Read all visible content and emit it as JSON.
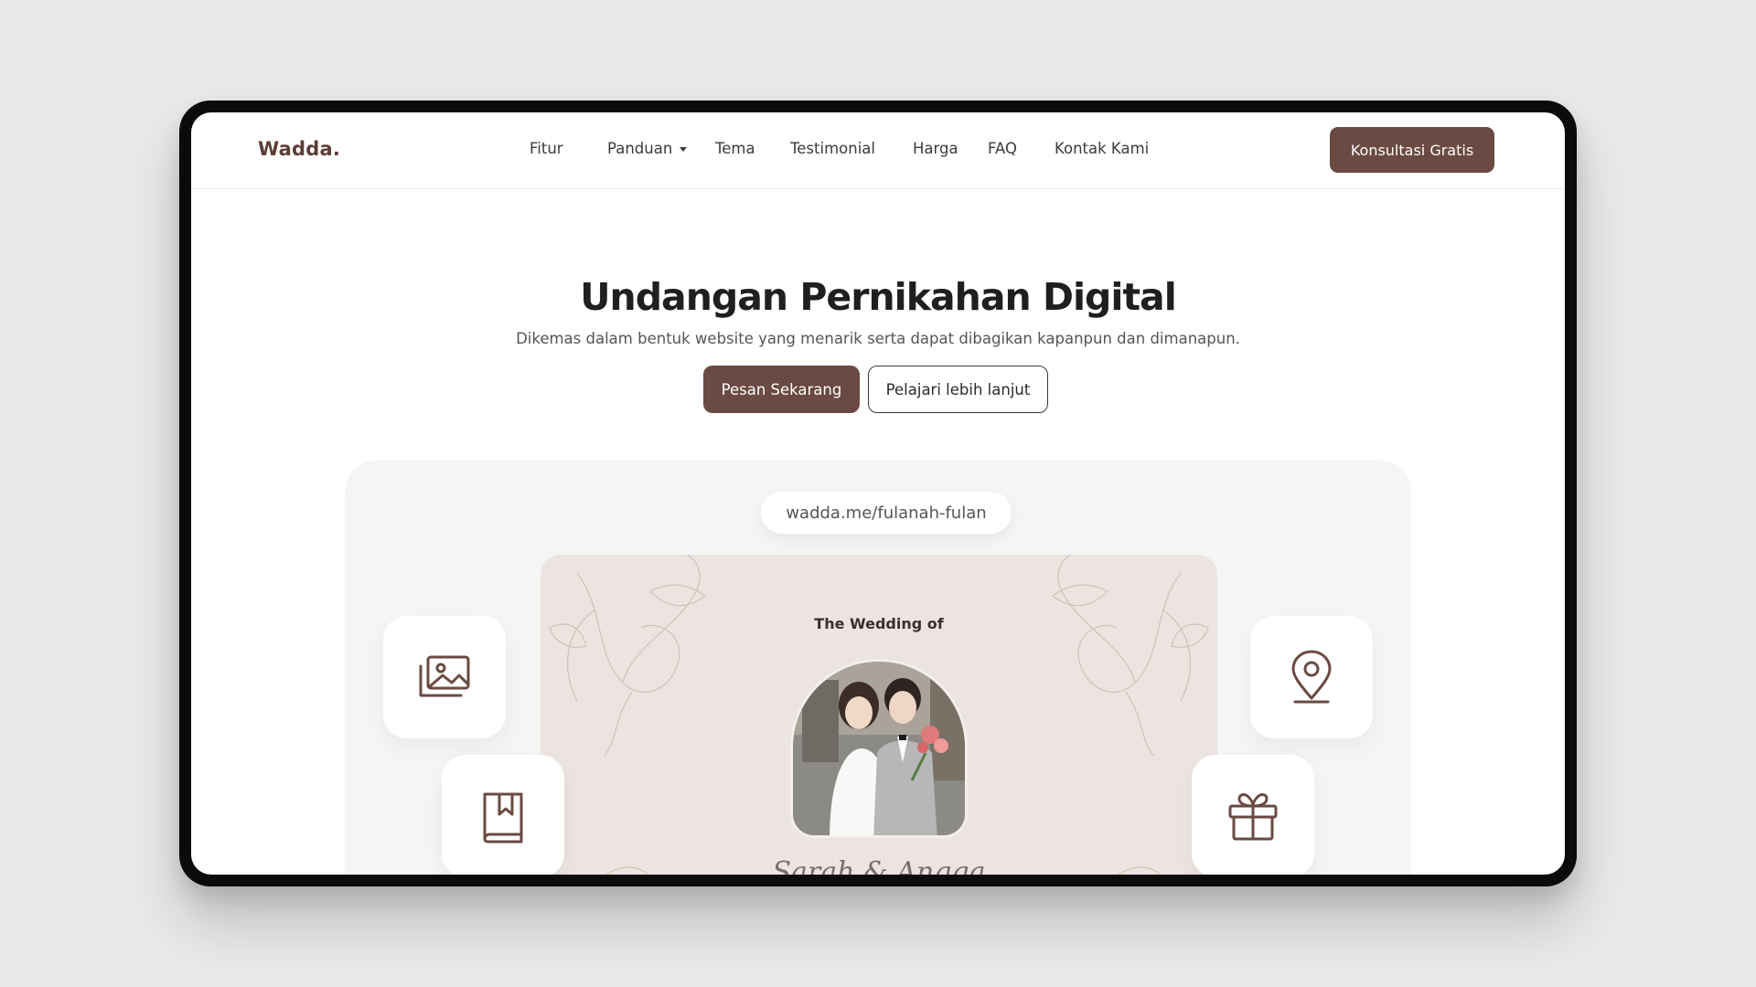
{
  "brand": {
    "logo": "Wadda."
  },
  "nav": {
    "items": [
      {
        "label": "Fitur"
      },
      {
        "label": "Panduan",
        "dropdown": true
      },
      {
        "label": "Tema"
      },
      {
        "label": "Testimonial"
      },
      {
        "label": "Harga"
      },
      {
        "label": "FAQ"
      },
      {
        "label": "Kontak Kami"
      }
    ],
    "cta_label": "Konsultasi Gratis"
  },
  "hero": {
    "title": "Undangan Pernikahan Digital",
    "subtitle": "Dikemas dalam bentuk website yang menarik serta dapat dibagikan kapanpun dan dimanapun.",
    "primary_label": "Pesan Sekarang",
    "secondary_label": "Pelajari lebih lanjut"
  },
  "preview": {
    "url": "wadda.me/fulanah-fulan",
    "card_title": "The Wedding of",
    "couple_names": "Sarah & Angga",
    "tiles": [
      {
        "icon": "gallery-icon"
      },
      {
        "icon": "guestbook-icon"
      },
      {
        "icon": "location-pin-icon"
      },
      {
        "icon": "gift-icon"
      }
    ]
  },
  "colors": {
    "brand": "#6a4a42",
    "logo": "#5b3e36",
    "card_bg": "#ece4e1"
  }
}
